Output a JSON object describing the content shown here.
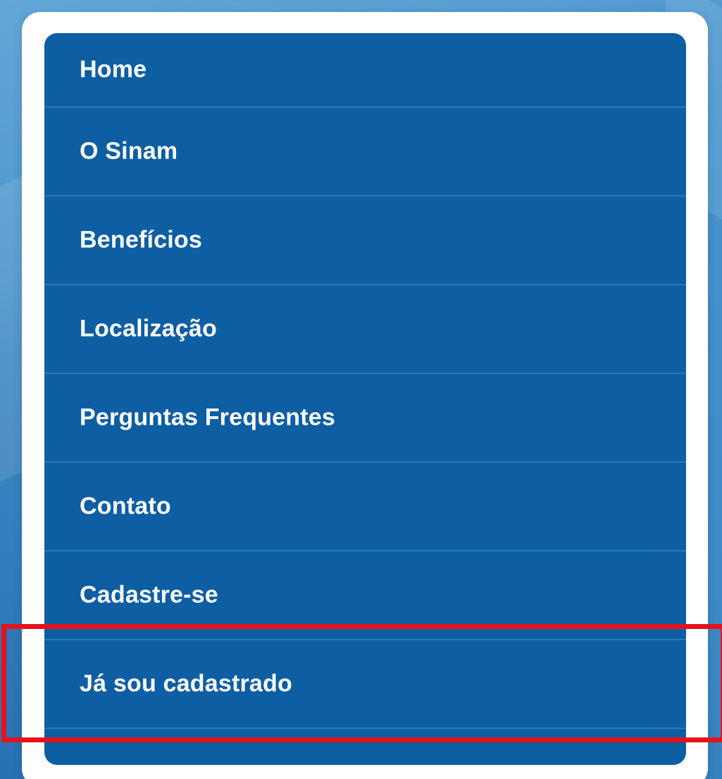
{
  "menu": {
    "items": [
      {
        "label": "Home"
      },
      {
        "label": "O Sinam"
      },
      {
        "label": "Benefícios"
      },
      {
        "label": "Localização"
      },
      {
        "label": "Perguntas Frequentes"
      },
      {
        "label": "Contato"
      },
      {
        "label": "Cadastre-se"
      },
      {
        "label": "Já sou cadastrado"
      }
    ],
    "highlighted_item": "Já sou cadastrado"
  },
  "colors": {
    "menu_background": "#0e5ea3",
    "divider": "#2e78b8",
    "text": "#ffffff",
    "highlight": "#e4131a",
    "page_background": "#3f8bc4"
  }
}
